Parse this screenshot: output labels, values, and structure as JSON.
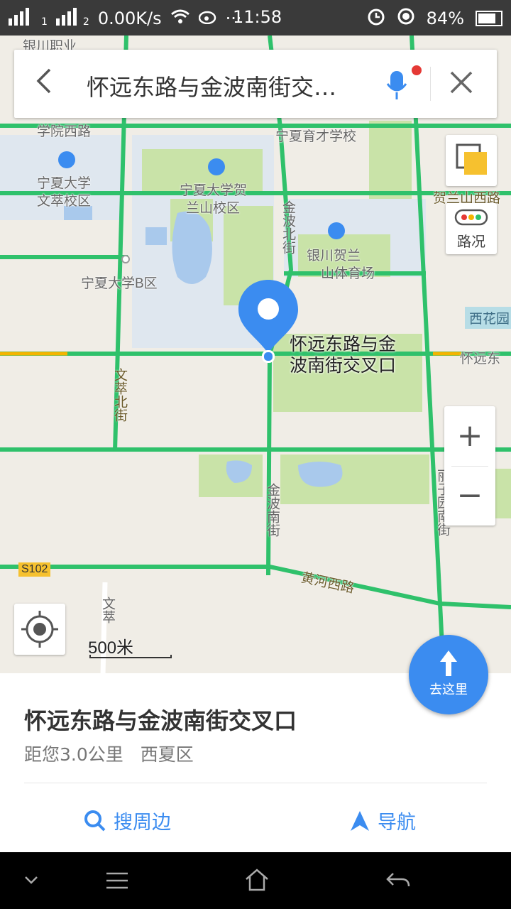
{
  "status_bar": {
    "network_speed": "0.00K/s",
    "signal_label_1": "1",
    "signal_label_2": "2",
    "time": "11:58",
    "battery": "84%"
  },
  "search_bar": {
    "query": "怀远东路与金波南街交…"
  },
  "map": {
    "labels": [
      "银川职业",
      "学院西路",
      "宁夏育才学校",
      "宁夏大学",
      "文萃校区",
      "宁夏大学贺",
      "兰山校区",
      "贺兰山西路",
      "宁夏大学B区",
      "银川贺兰",
      "山体育场",
      "西花园",
      "怀远东",
      "S102",
      "黄河西路"
    ],
    "vertical_labels": [
      "金波北街",
      "文萃北街",
      "金波南街",
      "丽子园南街",
      "文萃"
    ],
    "pin_label": "怀远东路与金波南街交叉口",
    "scale": "500米"
  },
  "controls": {
    "traffic_label": "路况",
    "zoom_in": "+",
    "zoom_out": "−",
    "go_label": "去这里"
  },
  "sheet": {
    "title": "怀远东路与金波南街交叉口",
    "distance": "距您3.0公里",
    "district": "西夏区",
    "search_nearby": "搜周边",
    "navigate": "导航"
  },
  "colors": {
    "accent": "#3b8cf0",
    "road_green": "#2fc16b",
    "road_yellow": "#f4b400",
    "park_green": "#c9e3a8",
    "water_blue": "#a9c9ec"
  }
}
